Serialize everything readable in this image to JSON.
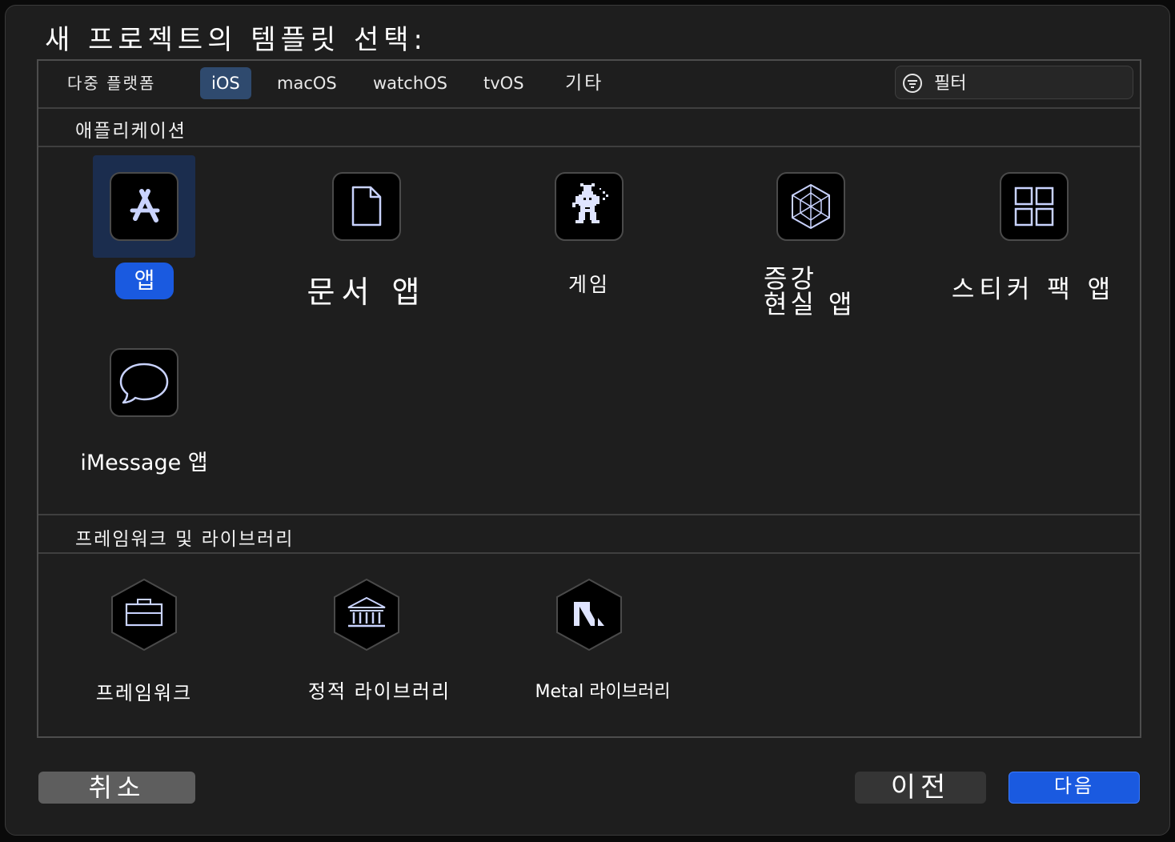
{
  "window": {
    "title": "새 프로젝트의 템플릿 선택:"
  },
  "tabs": [
    {
      "label": "다중 플랫폼",
      "selected": false
    },
    {
      "label": "iOS",
      "selected": true
    },
    {
      "label": "macOS",
      "selected": false
    },
    {
      "label": "watchOS",
      "selected": false
    },
    {
      "label": "tvOS",
      "selected": false
    },
    {
      "label": "기타",
      "selected": false
    }
  ],
  "filter": {
    "placeholder": "필터",
    "icon": "filter-icon"
  },
  "sections": {
    "applications": {
      "title": "애플리케이션",
      "items": [
        {
          "label": "앱",
          "icon": "app-store-icon",
          "selected": true
        },
        {
          "label": "문서 앱",
          "icon": "document-icon",
          "selected": false
        },
        {
          "label": "게임",
          "icon": "game-sprite-icon",
          "selected": false
        },
        {
          "label_line1": "증강",
          "label_line2": "현실 앱",
          "icon": "ar-cube-icon",
          "selected": false
        },
        {
          "label": "스티커 팩 앱",
          "icon": "grid-icon",
          "selected": false
        },
        {
          "label": "iMessage 앱",
          "icon": "message-bubble-icon",
          "selected": false
        }
      ]
    },
    "frameworks": {
      "title": "프레임워크 및 라이브러리",
      "items": [
        {
          "label": "프레임워크",
          "icon": "toolbox-icon"
        },
        {
          "label": "정적 라이브러리",
          "icon": "library-building-icon"
        },
        {
          "label": "Metal 라이브러리",
          "icon": "metal-icon"
        }
      ]
    }
  },
  "buttons": {
    "cancel": "취소",
    "previous": "이전",
    "next": "다음"
  },
  "colors": {
    "accent": "#1a5ae0",
    "selection_bg": "#1b2d4e",
    "active_tab": "#2f4a6e",
    "icon_line": "#c9d3ff"
  }
}
